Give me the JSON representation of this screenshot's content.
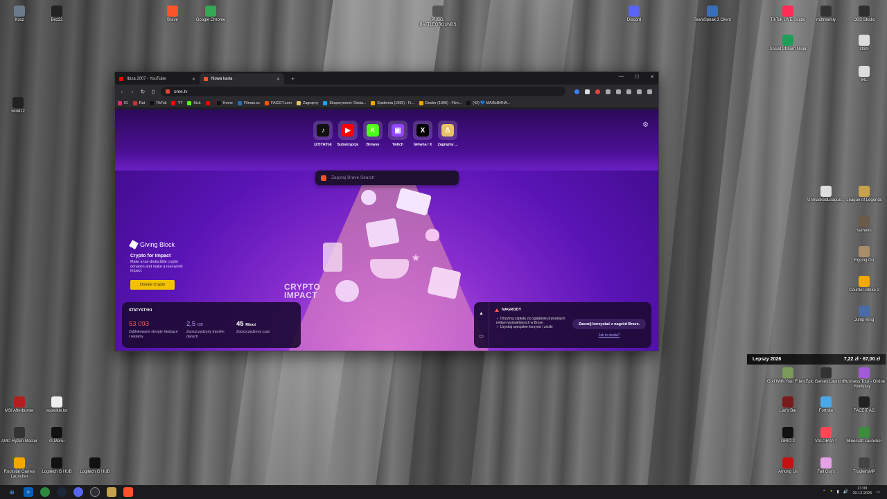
{
  "desktop": {
    "icons": [
      {
        "label": "Kosz"
      },
      {
        "label": "Bez22"
      },
      {
        "label": "Brave"
      },
      {
        "label": "Google Chrome"
      },
      {
        "label": "PUBG: BATTLEGROUNDS"
      },
      {
        "label": "Discord"
      },
      {
        "label": "TeamSpeak 3 Client"
      },
      {
        "label": "TikTok LIVE Studio"
      },
      {
        "label": "m3treamly"
      },
      {
        "label": "OBS Studio"
      },
      {
        "label": "Social Stream Ninja"
      },
      {
        "label": "strim"
      },
      {
        "label": "IRL"
      },
      {
        "label": "vddd12"
      },
      {
        "label": "UnmaskedLeague..."
      },
      {
        "label": "League of Legends"
      },
      {
        "label": "Valheim"
      },
      {
        "label": "Egging On"
      },
      {
        "label": "Counter-Strike 2"
      },
      {
        "label": "Jump King"
      },
      {
        "label": "Golf With Your Friends"
      },
      {
        "label": "Epic Games Launcher"
      },
      {
        "label": "Business Tour - Online Multiplay..."
      },
      {
        "label": "MSI Afterburner"
      },
      {
        "label": "wszelkie.txt"
      },
      {
        "label": "AMD Ryzen Master"
      },
      {
        "label": "G-Menu"
      },
      {
        "label": "Liar's Bar"
      },
      {
        "label": "Fortnite"
      },
      {
        "label": "FACEIT AC"
      },
      {
        "label": "GRID 2"
      },
      {
        "label": "VALORANT"
      },
      {
        "label": "Minecraft Launcher"
      },
      {
        "label": "Rockstar Games Launcher"
      },
      {
        "label": "Logitech G HUB"
      },
      {
        "label": "Logitech G HUB"
      },
      {
        "label": "Among Us"
      },
      {
        "label": "Fall Guys"
      },
      {
        "label": "TruckersMP"
      }
    ],
    "widget": {
      "title": "Lepszy 2026",
      "value1": "7,22 zł",
      "value2": "67,00 zł"
    }
  },
  "browser": {
    "tabs": [
      {
        "title": "Ibiza 2007 - YouTube",
        "color": "#ff0000"
      },
      {
        "title": "Nowa karta",
        "color": "#fb542b"
      }
    ],
    "url": "ome.tv",
    "bookmarks": [
      "IG",
      "Rat",
      "TikTok",
      "YT",
      "Kick",
      "",
      "Home",
      "Filman.cc",
      "FACEIT.com",
      "Zagrajmy",
      "Eksperyment: Odsia...",
      "Epidemia (1995) - Fi...",
      "Dealer (1996) - Film...",
      "(42) 💙 МАЛЬВИНА..."
    ],
    "top_sites": [
      {
        "label": "(27)TikTok",
        "glyph": "♪",
        "color": "#111111"
      },
      {
        "label": "Subskrypcje",
        "glyph": "▶",
        "color": "#ff0000"
      },
      {
        "label": "Browse",
        "glyph": "K",
        "color": "#53fc18"
      },
      {
        "label": "Twitch",
        "glyph": "▣",
        "color": "#9146ff"
      },
      {
        "label": "Główna / X",
        "glyph": "X",
        "color": "#000000"
      },
      {
        "label": "Zagrajmy ...",
        "glyph": "♙",
        "color": "#e8c26a"
      }
    ],
    "search_placeholder": "Zapytaj Brave Search",
    "giving_block": {
      "brand": "Giving Block",
      "heading": "Crypto for Impact",
      "text": "Make a tax-deductible crypto donation and make a real-world impact.",
      "button": "Donate Crypto"
    },
    "crypto_impact": {
      "line1": "CRYPTO",
      "line2": "IMPACT"
    },
    "stats": {
      "title": "STATYSTYKI",
      "items": [
        {
          "value": "53 093",
          "unit": "",
          "desc": "Zablokowane skrypty śledzące i reklamy"
        },
        {
          "value": "2,5",
          "unit": "GB",
          "desc": "Zaoszczędzony transfer danych"
        },
        {
          "value": "45",
          "unit": "Minut",
          "desc": "Zaoszczędzony czas"
        }
      ]
    },
    "rewards": {
      "title": "NAGRODY",
      "items": [
        "Otrzymuj zapłatę za oglądanie prywatnych reklam wyświetlanych w Brave",
        "Uzyskaj specjalne korzyści i zniżki"
      ],
      "cta": "Zacznij korzystać z nagród Brave.",
      "link": "Jak to działa?"
    }
  },
  "taskbar": {
    "time": "21:09",
    "date": "20.12.2025"
  }
}
